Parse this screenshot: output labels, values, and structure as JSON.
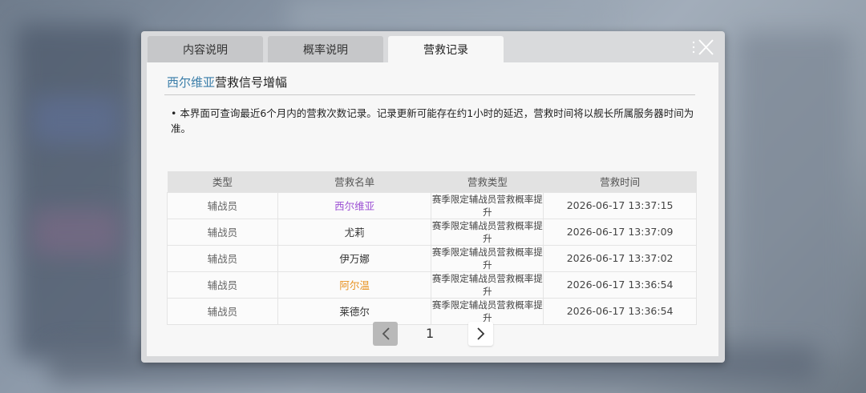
{
  "tabs": [
    {
      "label": "内容说明"
    },
    {
      "label": "概率说明"
    },
    {
      "label": "营救记录"
    }
  ],
  "title": {
    "highlight": "西尔维亚",
    "rest": "营救信号增幅"
  },
  "note": "• 本界面可查询最近6个月内的营救次数记录。记录更新可能存在约1小时的延迟，营救时间将以舰长所属服务器时间为准。",
  "table": {
    "headers": [
      "类型",
      "营救名单",
      "营救类型",
      "营救时间"
    ],
    "rows": [
      {
        "type": "辅战员",
        "name": "西尔维亚",
        "service": "赛季限定辅战员营救概率提升",
        "time": "2026-06-17 13:37:15"
      },
      {
        "type": "辅战员",
        "name": "尤莉",
        "service": "赛季限定辅战员营救概率提升",
        "time": "2026-06-17 13:37:09"
      },
      {
        "type": "辅战员",
        "name": "伊万娜",
        "service": "赛季限定辅战员营救概率提升",
        "time": "2026-06-17 13:37:02"
      },
      {
        "type": "辅战员",
        "name": "阿尔温",
        "service": "赛季限定辅战员营救概率提升",
        "time": "2026-06-17 13:36:54"
      },
      {
        "type": "辅战员",
        "name": "莱德尔",
        "service": "赛季限定辅战员营救概率提升",
        "time": "2026-06-17 13:36:54"
      }
    ]
  },
  "pager": {
    "current": "1"
  },
  "icons": {
    "close": "close-icon",
    "prev": "chevron-left-icon",
    "next": "chevron-right-icon"
  },
  "colors": {
    "highlight": "#3b7ea9",
    "purple_name": "#9b4fd3",
    "orange_name": "#e8911e"
  }
}
